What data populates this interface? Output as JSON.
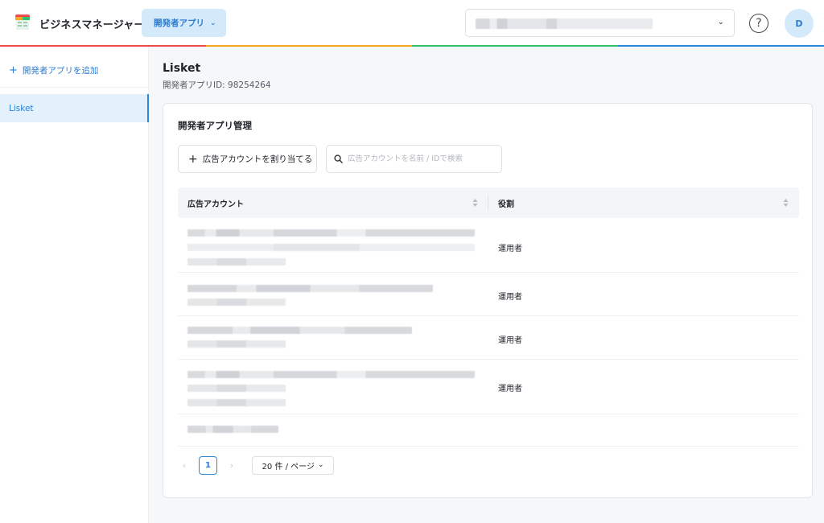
{
  "header": {
    "brand": "ビジネスマネージャー",
    "app_switcher": {
      "label": "開発者アプリ",
      "chevron": "⌄"
    },
    "account_select": {
      "chevron": "⌄"
    },
    "help": {
      "icon": "help-circle-icon",
      "glyph": "?"
    },
    "avatar": {
      "initial": "D"
    },
    "rainbow_colors": [
      "#ef4b4b",
      "#f6a623",
      "#34c06b",
      "#2b8ad8"
    ]
  },
  "sidebar": {
    "add_app_label": "開発者アプリを追加",
    "items": [
      {
        "label": "Lisket",
        "active": true
      }
    ]
  },
  "main": {
    "title": "Lisket",
    "subtitle": "開発者アプリID: 98254264",
    "card": {
      "title": "開発者アプリ管理",
      "assign_button": "広告アカウントを割り当てる",
      "search_placeholder": "広告アカウントを名前 / IDで検索",
      "table": {
        "columns": [
          "広告アカウント",
          "役割"
        ],
        "rows": [
          {
            "account": "",
            "role": "運用者"
          },
          {
            "account": "",
            "role": "運用者"
          },
          {
            "account": "",
            "role": "運用者"
          },
          {
            "account": "",
            "role": "運用者"
          },
          {
            "account": "",
            "role": ""
          }
        ]
      },
      "pagination": {
        "prev": "‹",
        "current_page": "1",
        "next": "›",
        "page_size": "20 件 / ページ",
        "chevron": "⌄"
      }
    }
  },
  "colors": {
    "accent": "#2b8ad8",
    "accent_soft": "#d4eafa",
    "text": "#1f2329"
  }
}
